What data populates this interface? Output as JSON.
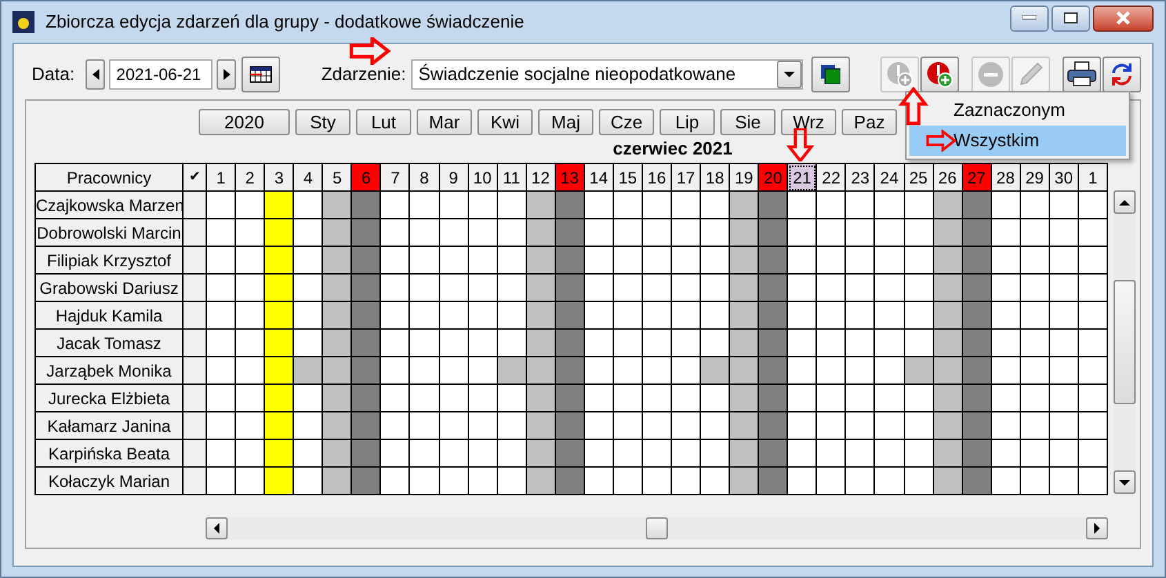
{
  "window": {
    "title": "Zbiorcza edycja zdarzeń dla grupy  - dodatkowe świadczenie"
  },
  "toolbar": {
    "date_label": "Data:",
    "date_value": "2021-06-21",
    "event_label": "Zdarzenie:",
    "event_value": "Świadczenie socjalne nieopodatkowane"
  },
  "toolbar_buttons": [
    {
      "kind": "add",
      "disabled": true
    },
    {
      "kind": "addred",
      "disabled": false
    },
    {
      "kind": "remove",
      "disabled": true
    },
    {
      "kind": "edit",
      "disabled": true
    },
    {
      "kind": "print",
      "disabled": false
    },
    {
      "kind": "refresh",
      "disabled": false
    }
  ],
  "months": [
    "2020",
    "Sty",
    "Lut",
    "Mar",
    "Kwi",
    "Maj",
    "Cze",
    "Lip",
    "Sie",
    "Wrz",
    "Paz"
  ],
  "menu": [
    {
      "label": "Zaznaczonym",
      "selected": false
    },
    {
      "label": "Wszystkim",
      "selected": true
    }
  ],
  "calendar_title": "czerwiec 2021",
  "table": {
    "name_header": "Pracownicy",
    "check_header": "✔",
    "days": [
      {
        "label": "1",
        "kind": "normal"
      },
      {
        "label": "2",
        "kind": "normal"
      },
      {
        "label": "3",
        "kind": "normal"
      },
      {
        "label": "4",
        "kind": "normal"
      },
      {
        "label": "5",
        "kind": "normal"
      },
      {
        "label": "6",
        "kind": "sunday"
      },
      {
        "label": "7",
        "kind": "normal"
      },
      {
        "label": "8",
        "kind": "normal"
      },
      {
        "label": "9",
        "kind": "normal"
      },
      {
        "label": "10",
        "kind": "normal"
      },
      {
        "label": "11",
        "kind": "normal"
      },
      {
        "label": "12",
        "kind": "normal"
      },
      {
        "label": "13",
        "kind": "sunday"
      },
      {
        "label": "14",
        "kind": "normal"
      },
      {
        "label": "15",
        "kind": "normal"
      },
      {
        "label": "16",
        "kind": "normal"
      },
      {
        "label": "17",
        "kind": "normal"
      },
      {
        "label": "18",
        "kind": "normal"
      },
      {
        "label": "19",
        "kind": "normal"
      },
      {
        "label": "20",
        "kind": "sunday"
      },
      {
        "label": "21",
        "kind": "current"
      },
      {
        "label": "22",
        "kind": "normal"
      },
      {
        "label": "23",
        "kind": "normal"
      },
      {
        "label": "24",
        "kind": "normal"
      },
      {
        "label": "25",
        "kind": "normal"
      },
      {
        "label": "26",
        "kind": "normal"
      },
      {
        "label": "27",
        "kind": "sunday"
      },
      {
        "label": "28",
        "kind": "normal"
      },
      {
        "label": "29",
        "kind": "normal"
      },
      {
        "label": "30",
        "kind": "normal"
      },
      {
        "label": "1",
        "kind": "normal"
      }
    ],
    "rows": [
      {
        "name": "Czajkowska Marzen",
        "cells": [
          {
            "kind": "empty"
          },
          {
            "kind": "empty"
          },
          {
            "kind": "holiday"
          },
          {
            "kind": "empty"
          },
          {
            "kind": "light"
          },
          {
            "kind": "dark"
          },
          {
            "kind": "empty"
          },
          {
            "kind": "empty"
          },
          {
            "kind": "empty"
          },
          {
            "kind": "empty"
          },
          {
            "kind": "empty"
          },
          {
            "kind": "light"
          },
          {
            "kind": "dark"
          },
          {
            "kind": "empty"
          },
          {
            "kind": "empty"
          },
          {
            "kind": "empty"
          },
          {
            "kind": "empty"
          },
          {
            "kind": "empty"
          },
          {
            "kind": "light"
          },
          {
            "kind": "dark"
          },
          {
            "kind": "empty"
          },
          {
            "kind": "empty"
          },
          {
            "kind": "empty"
          },
          {
            "kind": "empty"
          },
          {
            "kind": "empty"
          },
          {
            "kind": "light"
          },
          {
            "kind": "dark"
          },
          {
            "kind": "empty"
          },
          {
            "kind": "empty"
          },
          {
            "kind": "empty"
          },
          {
            "kind": "empty"
          }
        ]
      },
      {
        "name": "Dobrowolski Marcin",
        "cells": [
          {
            "kind": "empty"
          },
          {
            "kind": "empty"
          },
          {
            "kind": "holiday"
          },
          {
            "kind": "empty"
          },
          {
            "kind": "light"
          },
          {
            "kind": "dark"
          },
          {
            "kind": "empty"
          },
          {
            "kind": "empty"
          },
          {
            "kind": "empty"
          },
          {
            "kind": "empty"
          },
          {
            "kind": "empty"
          },
          {
            "kind": "light"
          },
          {
            "kind": "dark"
          },
          {
            "kind": "empty"
          },
          {
            "kind": "empty"
          },
          {
            "kind": "empty"
          },
          {
            "kind": "empty"
          },
          {
            "kind": "empty"
          },
          {
            "kind": "light"
          },
          {
            "kind": "dark"
          },
          {
            "kind": "empty"
          },
          {
            "kind": "empty"
          },
          {
            "kind": "empty"
          },
          {
            "kind": "empty"
          },
          {
            "kind": "empty"
          },
          {
            "kind": "light"
          },
          {
            "kind": "dark"
          },
          {
            "kind": "empty"
          },
          {
            "kind": "empty"
          },
          {
            "kind": "empty"
          },
          {
            "kind": "empty"
          }
        ]
      },
      {
        "name": "Filipiak Krzysztof",
        "cells": [
          {
            "kind": "empty"
          },
          {
            "kind": "empty"
          },
          {
            "kind": "holiday"
          },
          {
            "kind": "empty"
          },
          {
            "kind": "light"
          },
          {
            "kind": "dark"
          },
          {
            "kind": "empty"
          },
          {
            "kind": "empty"
          },
          {
            "kind": "empty"
          },
          {
            "kind": "empty"
          },
          {
            "kind": "empty"
          },
          {
            "kind": "light"
          },
          {
            "kind": "dark"
          },
          {
            "kind": "empty"
          },
          {
            "kind": "empty"
          },
          {
            "kind": "empty"
          },
          {
            "kind": "empty"
          },
          {
            "kind": "empty"
          },
          {
            "kind": "light"
          },
          {
            "kind": "dark"
          },
          {
            "kind": "empty"
          },
          {
            "kind": "empty"
          },
          {
            "kind": "empty"
          },
          {
            "kind": "empty"
          },
          {
            "kind": "empty"
          },
          {
            "kind": "light"
          },
          {
            "kind": "dark"
          },
          {
            "kind": "empty"
          },
          {
            "kind": "empty"
          },
          {
            "kind": "empty"
          },
          {
            "kind": "empty"
          }
        ]
      },
      {
        "name": "Grabowski Dariusz",
        "cells": [
          {
            "kind": "empty"
          },
          {
            "kind": "empty"
          },
          {
            "kind": "holiday"
          },
          {
            "kind": "empty"
          },
          {
            "kind": "light"
          },
          {
            "kind": "dark"
          },
          {
            "kind": "empty"
          },
          {
            "kind": "empty"
          },
          {
            "kind": "empty"
          },
          {
            "kind": "empty"
          },
          {
            "kind": "empty"
          },
          {
            "kind": "light"
          },
          {
            "kind": "dark"
          },
          {
            "kind": "empty"
          },
          {
            "kind": "empty"
          },
          {
            "kind": "empty"
          },
          {
            "kind": "empty"
          },
          {
            "kind": "empty"
          },
          {
            "kind": "light"
          },
          {
            "kind": "dark"
          },
          {
            "kind": "empty"
          },
          {
            "kind": "empty"
          },
          {
            "kind": "empty"
          },
          {
            "kind": "empty"
          },
          {
            "kind": "empty"
          },
          {
            "kind": "light"
          },
          {
            "kind": "dark"
          },
          {
            "kind": "empty"
          },
          {
            "kind": "empty"
          },
          {
            "kind": "empty"
          },
          {
            "kind": "empty"
          }
        ]
      },
      {
        "name": "Hajduk Kamila",
        "cells": [
          {
            "kind": "empty"
          },
          {
            "kind": "empty"
          },
          {
            "kind": "holiday"
          },
          {
            "kind": "empty"
          },
          {
            "kind": "light"
          },
          {
            "kind": "dark"
          },
          {
            "kind": "empty"
          },
          {
            "kind": "empty"
          },
          {
            "kind": "empty"
          },
          {
            "kind": "empty"
          },
          {
            "kind": "empty"
          },
          {
            "kind": "light"
          },
          {
            "kind": "dark"
          },
          {
            "kind": "empty"
          },
          {
            "kind": "empty"
          },
          {
            "kind": "empty"
          },
          {
            "kind": "empty"
          },
          {
            "kind": "empty"
          },
          {
            "kind": "light"
          },
          {
            "kind": "dark"
          },
          {
            "kind": "empty"
          },
          {
            "kind": "empty"
          },
          {
            "kind": "empty"
          },
          {
            "kind": "empty"
          },
          {
            "kind": "empty"
          },
          {
            "kind": "light"
          },
          {
            "kind": "dark"
          },
          {
            "kind": "empty"
          },
          {
            "kind": "empty"
          },
          {
            "kind": "empty"
          },
          {
            "kind": "empty"
          }
        ]
      },
      {
        "name": "Jacak Tomasz",
        "cells": [
          {
            "kind": "empty"
          },
          {
            "kind": "empty"
          },
          {
            "kind": "holiday"
          },
          {
            "kind": "empty"
          },
          {
            "kind": "light"
          },
          {
            "kind": "dark"
          },
          {
            "kind": "empty"
          },
          {
            "kind": "empty"
          },
          {
            "kind": "empty"
          },
          {
            "kind": "empty"
          },
          {
            "kind": "empty"
          },
          {
            "kind": "light"
          },
          {
            "kind": "dark"
          },
          {
            "kind": "empty"
          },
          {
            "kind": "empty"
          },
          {
            "kind": "empty"
          },
          {
            "kind": "empty"
          },
          {
            "kind": "empty"
          },
          {
            "kind": "light"
          },
          {
            "kind": "dark"
          },
          {
            "kind": "empty"
          },
          {
            "kind": "empty"
          },
          {
            "kind": "empty"
          },
          {
            "kind": "empty"
          },
          {
            "kind": "empty"
          },
          {
            "kind": "light"
          },
          {
            "kind": "dark"
          },
          {
            "kind": "empty"
          },
          {
            "kind": "empty"
          },
          {
            "kind": "empty"
          },
          {
            "kind": "empty"
          }
        ]
      },
      {
        "name": "Jarząbek Monika",
        "cells": [
          {
            "kind": "empty"
          },
          {
            "kind": "empty"
          },
          {
            "kind": "holiday"
          },
          {
            "kind": "light"
          },
          {
            "kind": "light"
          },
          {
            "kind": "dark"
          },
          {
            "kind": "empty"
          },
          {
            "kind": "empty"
          },
          {
            "kind": "empty"
          },
          {
            "kind": "empty"
          },
          {
            "kind": "light"
          },
          {
            "kind": "light"
          },
          {
            "kind": "dark"
          },
          {
            "kind": "empty"
          },
          {
            "kind": "empty"
          },
          {
            "kind": "empty"
          },
          {
            "kind": "empty"
          },
          {
            "kind": "light"
          },
          {
            "kind": "light"
          },
          {
            "kind": "dark"
          },
          {
            "kind": "empty"
          },
          {
            "kind": "empty"
          },
          {
            "kind": "empty"
          },
          {
            "kind": "empty"
          },
          {
            "kind": "light"
          },
          {
            "kind": "light"
          },
          {
            "kind": "dark"
          },
          {
            "kind": "empty"
          },
          {
            "kind": "empty"
          },
          {
            "kind": "empty"
          },
          {
            "kind": "empty"
          }
        ]
      },
      {
        "name": "Jurecka Elżbieta",
        "cells": [
          {
            "kind": "empty"
          },
          {
            "kind": "empty"
          },
          {
            "kind": "holiday"
          },
          {
            "kind": "empty"
          },
          {
            "kind": "light"
          },
          {
            "kind": "dark"
          },
          {
            "kind": "empty"
          },
          {
            "kind": "empty"
          },
          {
            "kind": "empty"
          },
          {
            "kind": "empty"
          },
          {
            "kind": "empty"
          },
          {
            "kind": "light"
          },
          {
            "kind": "dark"
          },
          {
            "kind": "empty"
          },
          {
            "kind": "empty"
          },
          {
            "kind": "empty"
          },
          {
            "kind": "empty"
          },
          {
            "kind": "empty"
          },
          {
            "kind": "light"
          },
          {
            "kind": "dark"
          },
          {
            "kind": "empty"
          },
          {
            "kind": "empty"
          },
          {
            "kind": "empty"
          },
          {
            "kind": "empty"
          },
          {
            "kind": "empty"
          },
          {
            "kind": "light"
          },
          {
            "kind": "dark"
          },
          {
            "kind": "empty"
          },
          {
            "kind": "empty"
          },
          {
            "kind": "empty"
          },
          {
            "kind": "empty"
          }
        ]
      },
      {
        "name": "Kałamarz Janina",
        "cells": [
          {
            "kind": "empty"
          },
          {
            "kind": "empty"
          },
          {
            "kind": "holiday"
          },
          {
            "kind": "empty"
          },
          {
            "kind": "light"
          },
          {
            "kind": "dark"
          },
          {
            "kind": "empty"
          },
          {
            "kind": "empty"
          },
          {
            "kind": "empty"
          },
          {
            "kind": "empty"
          },
          {
            "kind": "empty"
          },
          {
            "kind": "light"
          },
          {
            "kind": "dark"
          },
          {
            "kind": "empty"
          },
          {
            "kind": "empty"
          },
          {
            "kind": "empty"
          },
          {
            "kind": "empty"
          },
          {
            "kind": "empty"
          },
          {
            "kind": "light"
          },
          {
            "kind": "dark"
          },
          {
            "kind": "empty"
          },
          {
            "kind": "empty"
          },
          {
            "kind": "empty"
          },
          {
            "kind": "empty"
          },
          {
            "kind": "empty"
          },
          {
            "kind": "light"
          },
          {
            "kind": "dark"
          },
          {
            "kind": "empty"
          },
          {
            "kind": "empty"
          },
          {
            "kind": "empty"
          },
          {
            "kind": "empty"
          }
        ]
      },
      {
        "name": "Karpińska Beata",
        "cells": [
          {
            "kind": "empty"
          },
          {
            "kind": "empty"
          },
          {
            "kind": "holiday"
          },
          {
            "kind": "empty"
          },
          {
            "kind": "light"
          },
          {
            "kind": "dark"
          },
          {
            "kind": "empty"
          },
          {
            "kind": "empty"
          },
          {
            "kind": "empty"
          },
          {
            "kind": "empty"
          },
          {
            "kind": "empty"
          },
          {
            "kind": "light"
          },
          {
            "kind": "dark"
          },
          {
            "kind": "empty"
          },
          {
            "kind": "empty"
          },
          {
            "kind": "empty"
          },
          {
            "kind": "empty"
          },
          {
            "kind": "empty"
          },
          {
            "kind": "light"
          },
          {
            "kind": "dark"
          },
          {
            "kind": "empty"
          },
          {
            "kind": "empty"
          },
          {
            "kind": "empty"
          },
          {
            "kind": "empty"
          },
          {
            "kind": "empty"
          },
          {
            "kind": "light"
          },
          {
            "kind": "dark"
          },
          {
            "kind": "empty"
          },
          {
            "kind": "empty"
          },
          {
            "kind": "empty"
          },
          {
            "kind": "empty"
          }
        ]
      },
      {
        "name": "Kołaczyk Marian",
        "cells": [
          {
            "kind": "empty"
          },
          {
            "kind": "empty"
          },
          {
            "kind": "holiday"
          },
          {
            "kind": "empty"
          },
          {
            "kind": "light"
          },
          {
            "kind": "dark"
          },
          {
            "kind": "empty"
          },
          {
            "kind": "empty"
          },
          {
            "kind": "empty"
          },
          {
            "kind": "empty"
          },
          {
            "kind": "empty"
          },
          {
            "kind": "light"
          },
          {
            "kind": "dark"
          },
          {
            "kind": "empty"
          },
          {
            "kind": "empty"
          },
          {
            "kind": "empty"
          },
          {
            "kind": "empty"
          },
          {
            "kind": "empty"
          },
          {
            "kind": "light"
          },
          {
            "kind": "dark"
          },
          {
            "kind": "empty"
          },
          {
            "kind": "empty"
          },
          {
            "kind": "empty"
          },
          {
            "kind": "empty"
          },
          {
            "kind": "empty"
          },
          {
            "kind": "light"
          },
          {
            "kind": "dark"
          },
          {
            "kind": "empty"
          },
          {
            "kind": "empty"
          },
          {
            "kind": "empty"
          },
          {
            "kind": "empty"
          }
        ]
      }
    ]
  }
}
